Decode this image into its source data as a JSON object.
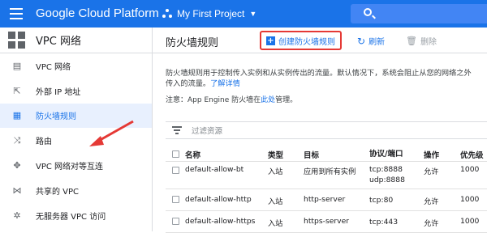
{
  "topbar": {
    "brand": "Google Cloud Platform",
    "project_label": "My First Project",
    "menu_icon": "hamburger-icon",
    "search_icon": "search-icon",
    "color": "#1a73e8"
  },
  "sidebar": {
    "header_title": "VPC 网络",
    "items": [
      {
        "label": "VPC 网络",
        "icon": "network-icon",
        "active": false
      },
      {
        "label": "外部 IP 地址",
        "icon": "external-ip-icon",
        "active": false
      },
      {
        "label": "防火墙规则",
        "icon": "firewall-icon",
        "active": true
      },
      {
        "label": "路由",
        "icon": "routes-icon",
        "active": false
      },
      {
        "label": "VPC 网络对等互连",
        "icon": "peering-icon",
        "active": false
      },
      {
        "label": "共享的 VPC",
        "icon": "shared-vpc-icon",
        "active": false
      },
      {
        "label": "无服务器 VPC 访问",
        "icon": "serverless-icon",
        "active": false
      }
    ]
  },
  "main": {
    "title": "防火墙规则",
    "create_label": "创建防火墙规则",
    "refresh_label": "刷新",
    "delete_label": "删除",
    "description": "防火墙规则用于控制传入实例和从实例传出的流量。默认情况下，系统会阻止从您的网络之外传入的流量。",
    "learn_more": "了解详情",
    "note_prefix": "注意：App Engine 防火墙在",
    "note_link": "此处",
    "note_suffix": "管理。",
    "filter_placeholder": "过滤资源",
    "columns": [
      "名称",
      "类型",
      "目标",
      "协议/端口",
      "操作",
      "优先级"
    ],
    "rows": [
      {
        "name": "default-allow-bt",
        "type": "入站",
        "target": "应用到所有实例",
        "proto1": "tcp:8888",
        "proto2": "udp:8888",
        "action": "允许",
        "priority": "1000"
      },
      {
        "name": "default-allow-http",
        "type": "入站",
        "target": "http-server",
        "proto1": "tcp:80",
        "proto2": "",
        "action": "允许",
        "priority": "1000"
      },
      {
        "name": "default-allow-https",
        "type": "入站",
        "target": "https-server",
        "proto1": "tcp:443",
        "proto2": "",
        "action": "允许",
        "priority": "1000"
      }
    ]
  },
  "annotation_color": "#e53935"
}
